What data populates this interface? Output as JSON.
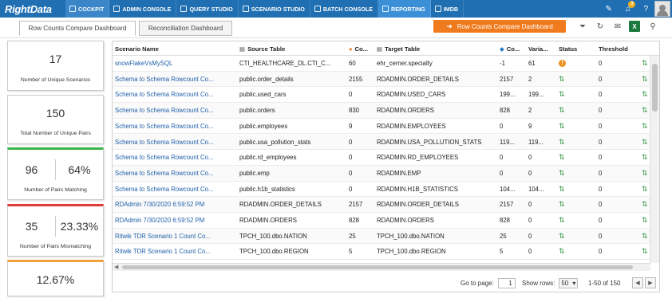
{
  "app": {
    "brand": "RightData"
  },
  "nav": [
    {
      "label": "COCKPIT",
      "icon": "cockpit-icon"
    },
    {
      "label": "ADMIN CONSOLE",
      "icon": "admin-icon"
    },
    {
      "label": "QUERY STUDIO",
      "icon": "query-icon"
    },
    {
      "label": "SCENARIO STUDIO",
      "icon": "scenario-icon"
    },
    {
      "label": "BATCH CONSOLE",
      "icon": "batch-icon"
    },
    {
      "label": "REPORTING",
      "icon": "reporting-icon"
    },
    {
      "label": "IMDB",
      "icon": "imdb-icon"
    }
  ],
  "topbar": {
    "notification_count": "3"
  },
  "tabs": [
    {
      "label": "Row Counts Compare Dashboard"
    },
    {
      "label": "Reconciliation Dashboard"
    }
  ],
  "toolbar": {
    "dashboard_button": "Row Counts Compare Dashboard",
    "excel_label": "X"
  },
  "cards": {
    "unique_scenarios": {
      "value": "17",
      "label": "Number of Unique Scenarios"
    },
    "unique_pairs": {
      "value": "150",
      "label": "Total Number of Unique Pairs"
    },
    "matching": {
      "count": "96",
      "percent": "64%",
      "label": "Number of Pairs Matching"
    },
    "mismatching": {
      "count": "35",
      "percent": "23.33%",
      "label": "Number of Pairs Mismatching"
    },
    "other": {
      "value": "12.67%"
    }
  },
  "grid": {
    "headers": {
      "scenario": "Scenario Name",
      "source": "Source Table",
      "src_count": "Co...",
      "target": "Target Table",
      "tgt_count": "Co...",
      "variance": "Varia...",
      "status": "Status",
      "threshold": "Threshold"
    },
    "rows": [
      {
        "scenario": "snowFlakeVsMySQL",
        "source": "CTI_HEALTHCARE_DL.CTI_C...",
        "src": "60",
        "target": "ehr_cerner.specialty",
        "tgt": "-1",
        "var": "61",
        "status": "warn",
        "thr": "0"
      },
      {
        "scenario": "Schema to Schema Rowcount Co...",
        "source": "public.order_details",
        "src": "2155",
        "target": "RDADMIN.ORDER_DETAILS",
        "tgt": "2157",
        "var": "2",
        "status": "ok",
        "thr": "0"
      },
      {
        "scenario": "Schema to Schema Rowcount Co...",
        "source": "public.used_cars",
        "src": "0",
        "target": "RDADMIN.USED_CARS",
        "tgt": "199...",
        "var": "199...",
        "status": "ok",
        "thr": "0"
      },
      {
        "scenario": "Schema to Schema Rowcount Co...",
        "source": "public.orders",
        "src": "830",
        "target": "RDADMIN.ORDERS",
        "tgt": "828",
        "var": "2",
        "status": "ok",
        "thr": "0"
      },
      {
        "scenario": "Schema to Schema Rowcount Co...",
        "source": "public.employees",
        "src": "9",
        "target": "RDADMIN.EMPLOYEES",
        "tgt": "0",
        "var": "9",
        "status": "ok",
        "thr": "0"
      },
      {
        "scenario": "Schema to Schema Rowcount Co...",
        "source": "public.usa_pollution_stats",
        "src": "0",
        "target": "RDADMIN.USA_POLLUTION_STATS",
        "tgt": "119...",
        "var": "119...",
        "status": "ok",
        "thr": "0"
      },
      {
        "scenario": "Schema to Schema Rowcount Co...",
        "source": "public.rd_employees",
        "src": "0",
        "target": "RDADMIN.RD_EMPLOYEES",
        "tgt": "0",
        "var": "0",
        "status": "ok",
        "thr": "0"
      },
      {
        "scenario": "Schema to Schema Rowcount Co...",
        "source": "public.emp",
        "src": "0",
        "target": "RDADMIN.EMP",
        "tgt": "0",
        "var": "0",
        "status": "ok",
        "thr": "0"
      },
      {
        "scenario": "Schema to Schema Rowcount Co...",
        "source": "public.h1b_statistics",
        "src": "0",
        "target": "RDADMIN.H1B_STATISTICS",
        "tgt": "104...",
        "var": "104...",
        "status": "ok",
        "thr": "0"
      },
      {
        "scenario": "RDAdmin 7/30/2020 6:59:52 PM",
        "source": "RDADMIN.ORDER_DETAILS",
        "src": "2157",
        "target": "RDADMIN.ORDER_DETAILS",
        "tgt": "2157",
        "var": "0",
        "status": "ok",
        "thr": "0"
      },
      {
        "scenario": "RDAdmin 7/30/2020 6:59:52 PM",
        "source": "RDADMIN.ORDERS",
        "src": "828",
        "target": "RDADMIN.ORDERS",
        "tgt": "828",
        "var": "0",
        "status": "ok",
        "thr": "0"
      },
      {
        "scenario": "Ritwik TDR Scenario 1 Count Co...",
        "source": "TPCH_100.dbo.NATION",
        "src": "25",
        "target": "TPCH_100.dbo.NATION",
        "tgt": "25",
        "var": "0",
        "status": "ok",
        "thr": "0"
      },
      {
        "scenario": "Ritwik TDR Scenario 1 Count Co...",
        "source": "TPCH_100.dbo.REGION",
        "src": "5",
        "target": "TPCH_100.dbo.REGION",
        "tgt": "5",
        "var": "0",
        "status": "ok",
        "thr": "0"
      }
    ]
  },
  "pager": {
    "go_to_label": "Go to page:",
    "page_value": "1",
    "show_rows_label": "Show rows:",
    "rows_value": "50",
    "range_text": "1-50 of 150"
  }
}
